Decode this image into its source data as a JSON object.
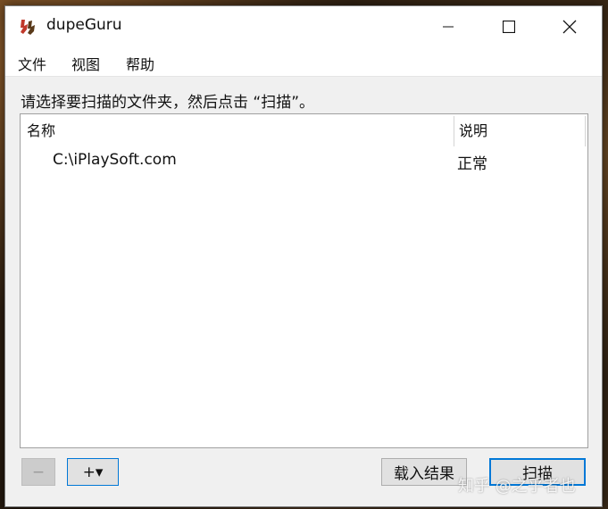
{
  "window": {
    "title": "dupeGuru"
  },
  "menu": {
    "items": [
      "文件",
      "视图",
      "帮助"
    ]
  },
  "instruction": "请选择要扫描的文件夹，然后点击 “扫描”。",
  "table": {
    "columns": [
      "名称",
      "说明"
    ],
    "rows": [
      {
        "name": "C:\\iPlaySoft.com",
        "status": "正常"
      }
    ]
  },
  "buttons": {
    "remove": "−",
    "add": "+▾",
    "load_results": "载入结果",
    "scan": "扫描"
  },
  "watermark": "知乎 @之乎者也",
  "icons": {
    "app": "dupeguru-app-icon",
    "minimize": "minimize-icon",
    "maximize": "maximize-icon",
    "close": "close-icon"
  },
  "colors": {
    "accent": "#0078d7",
    "app_icon": "#c0392b"
  }
}
